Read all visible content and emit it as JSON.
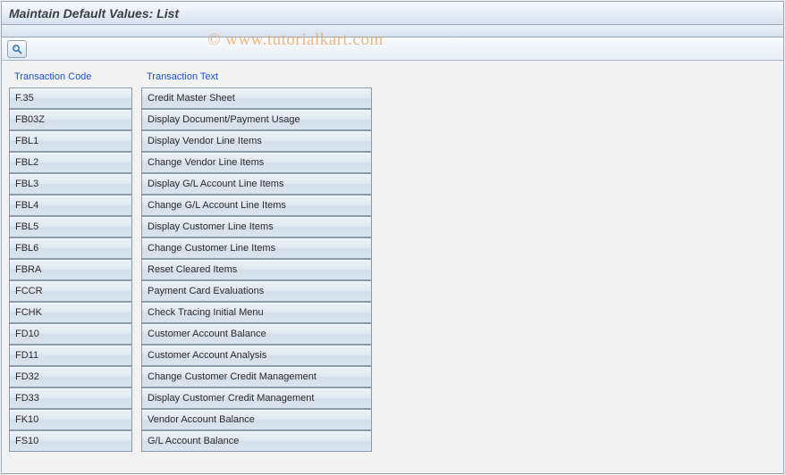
{
  "window": {
    "title": "Maintain Default Values: List"
  },
  "toolbar": {
    "choose_tooltip": "Choose"
  },
  "watermark": "© www.tutorialkart.com",
  "table": {
    "headers": {
      "code": "Transaction Code",
      "text": "Transaction Text"
    },
    "rows": [
      {
        "code": "F.35",
        "text": "Credit Master Sheet"
      },
      {
        "code": "FB03Z",
        "text": "Display Document/Payment Usage"
      },
      {
        "code": "FBL1",
        "text": "Display Vendor Line Items"
      },
      {
        "code": "FBL2",
        "text": "Change Vendor Line Items"
      },
      {
        "code": "FBL3",
        "text": "Display G/L Account Line Items"
      },
      {
        "code": "FBL4",
        "text": "Change G/L Account Line Items"
      },
      {
        "code": "FBL5",
        "text": "Display Customer Line Items"
      },
      {
        "code": "FBL6",
        "text": "Change Customer Line Items"
      },
      {
        "code": "FBRA",
        "text": "Reset Cleared Items"
      },
      {
        "code": "FCCR",
        "text": "Payment Card Evaluations"
      },
      {
        "code": "FCHK",
        "text": "Check Tracing Initial Menu"
      },
      {
        "code": "FD10",
        "text": "Customer Account Balance"
      },
      {
        "code": "FD11",
        "text": "Customer Account Analysis"
      },
      {
        "code": "FD32",
        "text": "Change Customer Credit Management"
      },
      {
        "code": "FD33",
        "text": "Display Customer Credit Management"
      },
      {
        "code": "FK10",
        "text": "Vendor Account Balance"
      },
      {
        "code": "FS10",
        "text": "G/L Account Balance"
      }
    ]
  }
}
